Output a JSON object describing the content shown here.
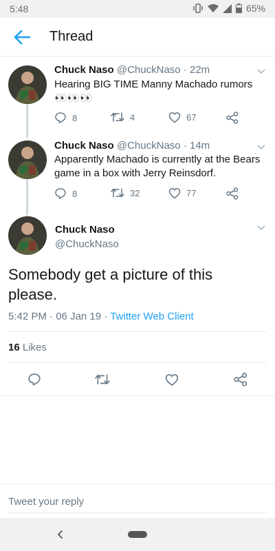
{
  "status_bar": {
    "time": "5:48",
    "battery": "65%"
  },
  "app_bar": {
    "title": "Thread"
  },
  "tweets": [
    {
      "name": "Chuck Naso",
      "handle": "@ChuckNaso",
      "age": "· 22m",
      "text": "Hearing BIG TIME Manny Machado rumors 👀👀👀",
      "replies": "8",
      "retweets": "4",
      "likes": "67"
    },
    {
      "name": "Chuck Naso",
      "handle": "@ChuckNaso",
      "age": "· 14m",
      "text": "Apparently Machado is currently at the Bears game in a box with Jerry Reinsdorf.",
      "replies": "8",
      "retweets": "32",
      "likes": "77"
    }
  ],
  "focus_tweet": {
    "name": "Chuck Naso",
    "handle": "@ChuckNaso",
    "text": "Somebody get a picture of this please.",
    "time": "5:42 PM",
    "date": "06 Jan 19",
    "separator": "·",
    "client": "Twitter Web Client",
    "likes_count": "16",
    "likes_label": "Likes"
  },
  "reply": {
    "placeholder": "Tweet your reply"
  },
  "colors": {
    "accent": "#1da1f2",
    "muted": "#657786",
    "text": "#14171a",
    "divider": "#e6ecf0"
  },
  "icons": [
    "back-arrow-icon",
    "chevron-down-icon",
    "reply-icon",
    "retweet-icon",
    "heart-icon",
    "share-icon",
    "wifi-icon",
    "signal-icon",
    "battery-icon",
    "vibrate-icon"
  ]
}
